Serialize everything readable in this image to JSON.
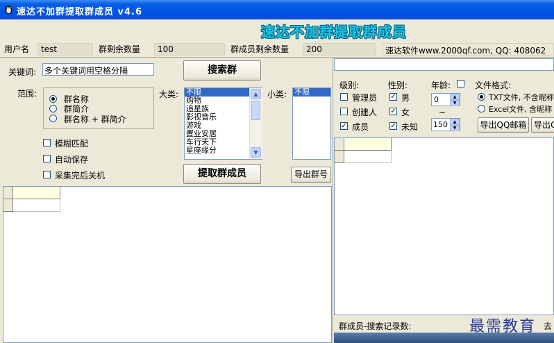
{
  "window": {
    "title": "速达不加群提取群成员 v4.6"
  },
  "banner": {
    "text": "速达不加群提取群成员"
  },
  "status": {
    "user_label": "用户名",
    "user_value": "test",
    "group_remaining_label": "群剩余数量",
    "group_remaining_value": "100",
    "member_remaining_label": "群成员剩余数量",
    "member_remaining_value": "200",
    "website": "速达软件www.2000qf.com, QQ: 408062"
  },
  "search": {
    "keyword_label": "关键词:",
    "keyword_value": "多个关键词用空格分隔",
    "search_button": "搜索群",
    "scope_label": "范围:",
    "scope_options": [
      "群名称",
      "群简介",
      "群名称 + 群简介"
    ],
    "category_label": "大类:",
    "categories": [
      "不限",
      "购物",
      "追星族",
      "影视音乐",
      "游戏",
      "置业安居",
      "车行天下",
      "星座缘分"
    ],
    "subcategory_label": "小类:",
    "subcategories": [
      "不限"
    ],
    "options": [
      "模糊匹配",
      "自动保存",
      "采集完后关机"
    ],
    "extract_button": "提取群成员",
    "export_groups_button": "导出群号"
  },
  "filters": {
    "level_label": "级别:",
    "levels": [
      "管理员",
      "创建人",
      "成员"
    ],
    "gender_label": "性别:",
    "genders": [
      "男",
      "女",
      "未知"
    ],
    "age_label": "年龄:",
    "age_min": "0",
    "age_sep": "~",
    "age_max": "150",
    "format_label": "文件格式:",
    "formats": [
      "TXT文件, 不含昵称",
      "Excel文件, 含昵称"
    ],
    "export_qq_email_button": "导出QQ邮箱",
    "export_qq_button": "导出Q"
  },
  "footer": {
    "member_search_label": "群成员-搜索记录数:",
    "cut": "去"
  },
  "watermark": {
    "text": "最需教育"
  }
}
